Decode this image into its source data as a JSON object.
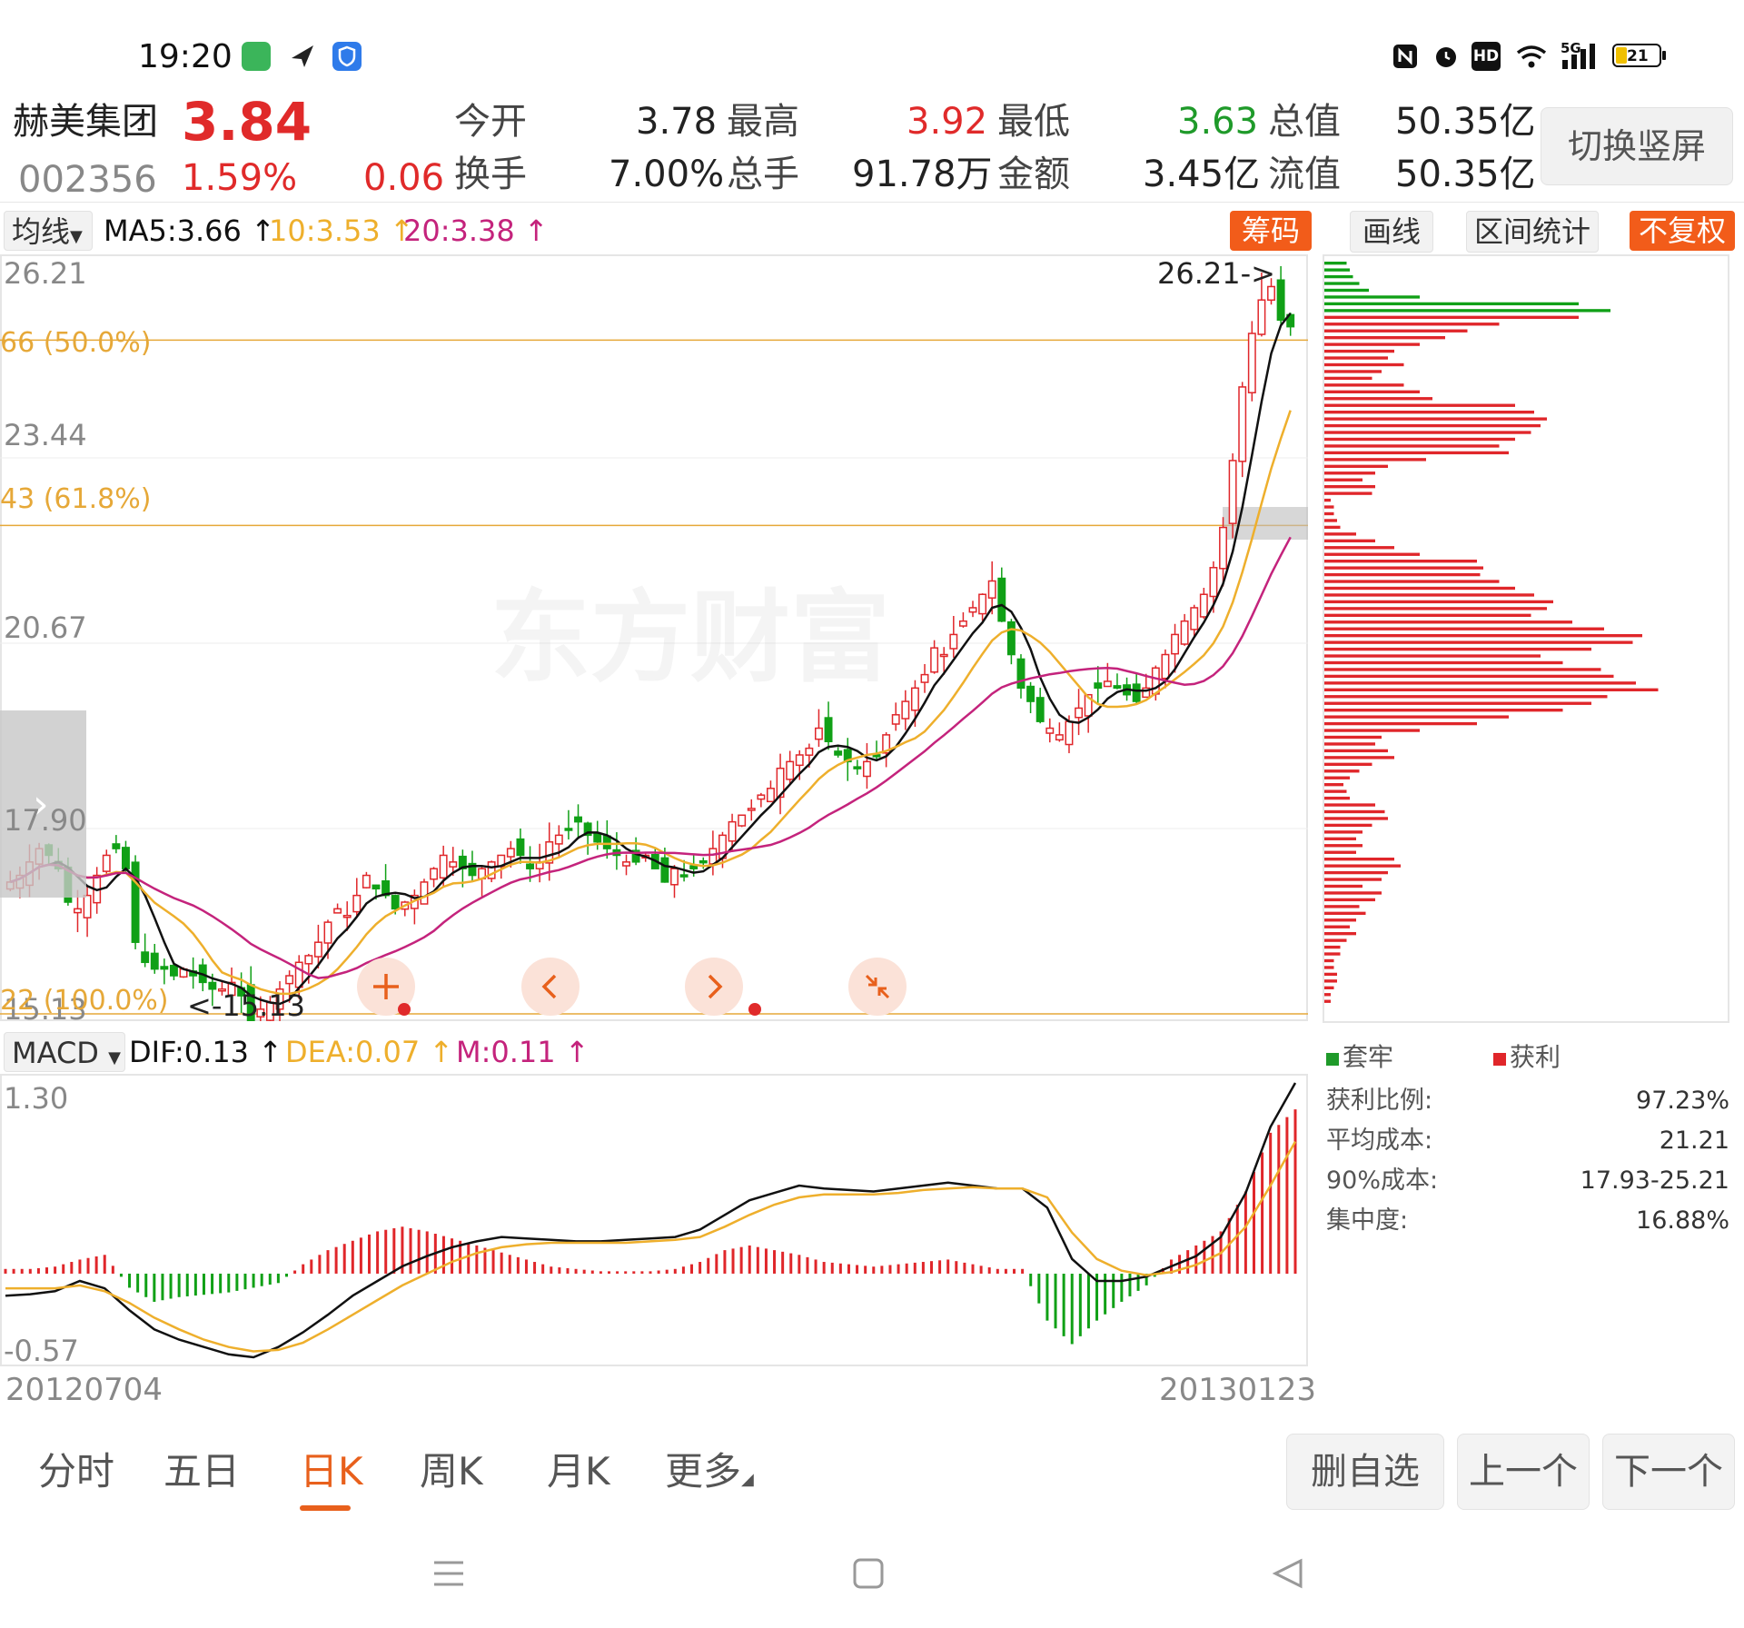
{
  "status_bar": {
    "time": "19:20",
    "left_icons": [
      "shield-app-icon",
      "paper-plane-icon",
      "security-icon"
    ],
    "right_icons": [
      "nfc-icon",
      "alarm-icon",
      "hd-icon",
      "wifi-icon",
      "signal-5g-icon",
      "battery-icon"
    ],
    "hd_label": "HD",
    "signal_label": "5G",
    "battery_level": "21"
  },
  "stock": {
    "name": "赫美集团",
    "price": "3.84",
    "code": "002356",
    "change_pct": "1.59%",
    "change": "0.06",
    "open_label": "今开",
    "open": "3.78",
    "high_label": "最高",
    "high": "3.92",
    "low_label": "最低",
    "low": "3.63",
    "mktcap_label": "总值",
    "mktcap": "50.35亿",
    "turnover_label": "换手",
    "turnover": "7.00%",
    "volume_label": "总手",
    "volume": "91.78万",
    "amount_label": "金额",
    "amount": "3.45亿",
    "float_label": "流值",
    "float_cap": "50.35亿",
    "switch_label": "切换竖屏"
  },
  "toolbar": {
    "ma_selector": "均线",
    "ma5": "MA5:3.66",
    "ma10": "10:3.53",
    "ma20": "20:3.38",
    "chip_btn": "筹码",
    "draw_btn": "画线",
    "range_btn": "区间统计",
    "adjust_btn": "不复权"
  },
  "colors": {
    "up_red": "#e0262a",
    "down_green": "#10a016",
    "ma5": "#111111",
    "ma10": "#eeaf2c",
    "ma20": "#c4237c",
    "orange": "#f25c1a",
    "fib": "#e6a838"
  },
  "kline": {
    "y_labels": [
      "26.21",
      "23.44",
      "20.67",
      "17.90",
      "15.13"
    ],
    "fib_labels": [
      "66 (50.0%)",
      "43 (61.8%)",
      "22 (100.0%)"
    ],
    "high_marker": "26.21->",
    "low_marker": "<-15.13",
    "watermark": "东方财富",
    "date_start": "20120704",
    "date_end": "20130123",
    "overlay_icons": [
      "plus-icon",
      "chevron-left-icon",
      "chevron-right-icon",
      "collapse-icon"
    ],
    "expand_icon": "chevron-right-icon"
  },
  "chart_data": [
    {
      "type": "candlestick",
      "title": "",
      "ylim": [
        15.13,
        26.21
      ],
      "ylabel": "",
      "closes": [
        17.1,
        17.2,
        17.4,
        17.6,
        17.5,
        17.3,
        16.8,
        16.7,
        16.9,
        17.2,
        17.5,
        17.6,
        17.3,
        16.2,
        15.9,
        15.8,
        15.8,
        15.7,
        15.8,
        15.7,
        15.6,
        15.5,
        15.5,
        15.6,
        15.4,
        15.0,
        15.2,
        15.3,
        15.5,
        15.7,
        15.9,
        16.0,
        16.2,
        16.5,
        16.7,
        16.6,
        16.9,
        17.2,
        17.0,
        16.9,
        16.7,
        16.8,
        16.9,
        17.1,
        17.3,
        17.5,
        17.4,
        17.3,
        17.2,
        17.3,
        17.4,
        17.5,
        17.6,
        17.5,
        17.3,
        17.4,
        17.7,
        17.8,
        17.9,
        18.0,
        17.8,
        17.7,
        17.6,
        17.5,
        17.4,
        17.4,
        17.5,
        17.3,
        17.1,
        17.3,
        17.2,
        17.3,
        17.4,
        17.6,
        17.8,
        18.0,
        18.1,
        18.2,
        18.4,
        18.5,
        18.8,
        18.9,
        19.0,
        19.1,
        19.4,
        19.2,
        19.0,
        18.9,
        18.8,
        18.9,
        19.0,
        19.3,
        19.6,
        19.8,
        20.0,
        20.2,
        20.6,
        20.5,
        20.8,
        21.0,
        21.2,
        21.4,
        21.6,
        21.0,
        20.5,
        20.0,
        19.8,
        19.5,
        19.4,
        19.3,
        19.5,
        19.7,
        19.9,
        20.0,
        20.1,
        20.0,
        19.9,
        19.8,
        20.0,
        20.3,
        20.5,
        20.8,
        21.0,
        21.2,
        21.4,
        21.8,
        22.4,
        23.4,
        24.5,
        25.3,
        25.8,
        26.0,
        25.5,
        25.4
      ],
      "high": 26.21,
      "low": 15.13,
      "fib_levels": [
        {
          "label": "66 (50.0%)",
          "value": 25.2
        },
        {
          "label": "43 (61.8%)",
          "value": 22.43
        },
        {
          "label": "22 (100.0%)",
          "value": 15.13
        }
      ],
      "series": [
        {
          "name": "MA5",
          "value": "3.66"
        },
        {
          "name": "10",
          "value": "3.53"
        },
        {
          "name": "20",
          "value": "3.38"
        }
      ]
    },
    {
      "type": "bar",
      "title": "MACD",
      "ylim": [
        -0.57,
        1.3
      ],
      "y_labels": [
        "1.30",
        "-0.57"
      ],
      "legend": {
        "selector": "MACD",
        "dif": "DIF:0.13",
        "dea": "DEA:0.07",
        "m": "M:0.11"
      },
      "dif": [
        -0.15,
        -0.14,
        -0.12,
        -0.05,
        -0.1,
        -0.25,
        -0.38,
        -0.45,
        -0.5,
        -0.55,
        -0.57,
        -0.5,
        -0.4,
        -0.28,
        -0.15,
        -0.05,
        0.05,
        0.12,
        0.18,
        0.22,
        0.25,
        0.24,
        0.23,
        0.22,
        0.22,
        0.23,
        0.24,
        0.25,
        0.3,
        0.4,
        0.5,
        0.55,
        0.6,
        0.58,
        0.57,
        0.56,
        0.58,
        0.6,
        0.62,
        0.6,
        0.58,
        0.58,
        0.45,
        0.1,
        -0.05,
        -0.05,
        -0.02,
        0.05,
        0.12,
        0.25,
        0.55,
        1.0,
        1.3
      ],
      "dea": [
        -0.1,
        -0.1,
        -0.1,
        -0.08,
        -0.12,
        -0.2,
        -0.3,
        -0.38,
        -0.45,
        -0.5,
        -0.53,
        -0.52,
        -0.47,
        -0.38,
        -0.28,
        -0.18,
        -0.08,
        0.0,
        0.08,
        0.14,
        0.18,
        0.2,
        0.21,
        0.21,
        0.21,
        0.21,
        0.22,
        0.23,
        0.25,
        0.32,
        0.4,
        0.47,
        0.52,
        0.54,
        0.54,
        0.54,
        0.55,
        0.57,
        0.58,
        0.59,
        0.58,
        0.58,
        0.52,
        0.28,
        0.1,
        0.02,
        -0.01,
        0.01,
        0.06,
        0.14,
        0.32,
        0.6,
        0.9
      ],
      "hist": [
        0.02,
        0.02,
        0.03,
        0.06,
        0.08,
        -0.06,
        -0.12,
        -0.1,
        -0.09,
        -0.08,
        -0.06,
        -0.04,
        0.04,
        0.1,
        0.14,
        0.18,
        0.2,
        0.18,
        0.15,
        0.12,
        0.09,
        0.06,
        0.03,
        0.02,
        0.01,
        0.01,
        0.01,
        0.02,
        0.05,
        0.1,
        0.12,
        0.1,
        0.08,
        0.05,
        0.04,
        0.03,
        0.04,
        0.05,
        0.06,
        0.04,
        0.02,
        0.02,
        -0.2,
        -0.3,
        -0.2,
        -0.12,
        -0.05,
        0.06,
        0.12,
        0.18,
        0.35,
        0.6,
        0.7
      ]
    }
  ],
  "chips": {
    "legend_trapped": "套牢",
    "legend_profit": "获利",
    "stats": [
      {
        "label": "获利比例:",
        "value": "97.23%"
      },
      {
        "label": "平均成本:",
        "value": "21.21"
      },
      {
        "label": "90%成本:",
        "value": "17.93-25.21"
      },
      {
        "label": "集中度:",
        "value": "16.88%"
      }
    ],
    "distribution": [
      0.07,
      0.08,
      0.09,
      0.11,
      0.14,
      0.3,
      0.8,
      0.9,
      0.8,
      0.55,
      0.45,
      0.38,
      0.3,
      0.22,
      0.2,
      0.25,
      0.18,
      0.15,
      0.25,
      0.3,
      0.34,
      0.6,
      0.66,
      0.7,
      0.68,
      0.65,
      0.6,
      0.55,
      0.58,
      0.32,
      0.2,
      0.16,
      0.12,
      0.16,
      0.15,
      0.02,
      0.03,
      0.03,
      0.04,
      0.05,
      0.1,
      0.16,
      0.22,
      0.3,
      0.48,
      0.5,
      0.49,
      0.55,
      0.6,
      0.66,
      0.72,
      0.7,
      0.65,
      0.78,
      0.88,
      1.0,
      0.97,
      0.84,
      0.68,
      0.75,
      0.87,
      0.91,
      0.98,
      1.05,
      0.89,
      0.84,
      0.75,
      0.58,
      0.48,
      0.3,
      0.18,
      0.16,
      0.2,
      0.22,
      0.15,
      0.11,
      0.08,
      0.06,
      0.07,
      0.08,
      0.16,
      0.19,
      0.2,
      0.15,
      0.12,
      0.1,
      0.12,
      0.1,
      0.22,
      0.24,
      0.2,
      0.18,
      0.12,
      0.18,
      0.16,
      0.11,
      0.13,
      0.1,
      0.08,
      0.1,
      0.07,
      0.05,
      0.05,
      0.03,
      0.03,
      0.04,
      0.04,
      0.03,
      0.02,
      0.02
    ]
  },
  "footer": {
    "tabs": [
      "分时",
      "五日",
      "日K",
      "周K",
      "月K",
      "更多"
    ],
    "active_tab": "日K",
    "buttons": [
      "删自选",
      "上一个",
      "下一个"
    ]
  },
  "nav": {
    "icons": [
      "menu-icon",
      "home-icon",
      "back-icon"
    ]
  }
}
